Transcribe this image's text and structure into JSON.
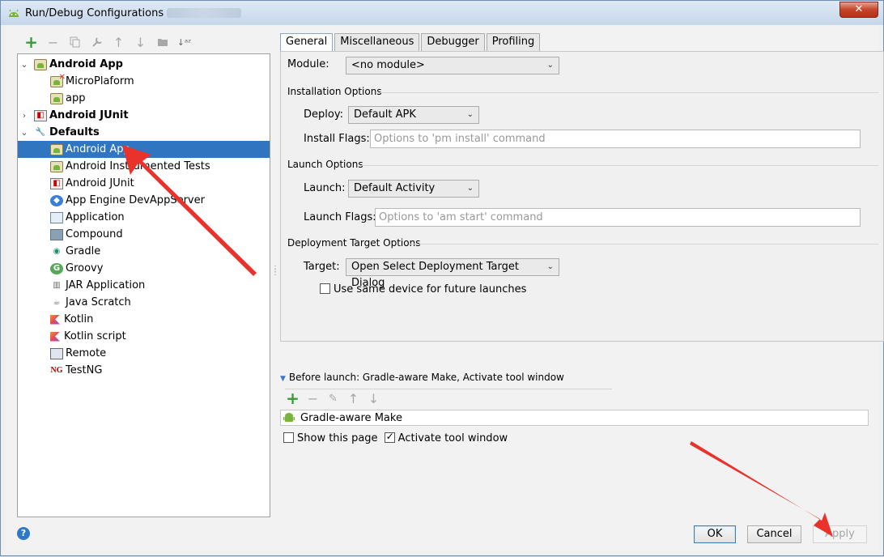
{
  "window": {
    "title": "Run/Debug Configurations",
    "close_label": "✕"
  },
  "left_toolbar": {
    "add_icon": "plus-icon",
    "remove_icon": "minus-icon",
    "copy_icon": "copy-icon",
    "edit_defaults_icon": "wrench-icon",
    "move_up_icon": "arrow-up-icon",
    "move_down_icon": "arrow-down-icon",
    "folder_icon": "folder-icon",
    "sort_icon": "sort-az-icon"
  },
  "tree": {
    "items": [
      {
        "label": "Android App",
        "level": 0,
        "bold": true,
        "expanded": true,
        "icon": "android-icon"
      },
      {
        "label": "MicroPlaform",
        "level": 1,
        "bold": false,
        "icon": "android-error-icon"
      },
      {
        "label": "app",
        "level": 1,
        "bold": false,
        "icon": "android-icon"
      },
      {
        "label": "Android JUnit",
        "level": 0,
        "bold": true,
        "expanded": false,
        "icon": "junit-icon"
      },
      {
        "label": "Defaults",
        "level": 0,
        "bold": true,
        "expanded": true,
        "icon": "wrench-icon"
      },
      {
        "label": "Android App",
        "level": 1,
        "bold": false,
        "selected": true,
        "icon": "android-icon"
      },
      {
        "label": "Android Instrumented Tests",
        "level": 1,
        "bold": false,
        "icon": "android-icon"
      },
      {
        "label": "Android JUnit",
        "level": 1,
        "bold": false,
        "icon": "junit-icon"
      },
      {
        "label": "App Engine DevAppServer",
        "level": 1,
        "bold": false,
        "icon": "appengine-icon"
      },
      {
        "label": "Application",
        "level": 1,
        "bold": false,
        "icon": "application-icon"
      },
      {
        "label": "Compound",
        "level": 1,
        "bold": false,
        "icon": "compound-icon"
      },
      {
        "label": "Gradle",
        "level": 1,
        "bold": false,
        "icon": "gradle-icon"
      },
      {
        "label": "Groovy",
        "level": 1,
        "bold": false,
        "icon": "groovy-icon"
      },
      {
        "label": "JAR Application",
        "level": 1,
        "bold": false,
        "icon": "jar-icon"
      },
      {
        "label": "Java Scratch",
        "level": 1,
        "bold": false,
        "icon": "java-scratch-icon"
      },
      {
        "label": "Kotlin",
        "level": 1,
        "bold": false,
        "icon": "kotlin-icon"
      },
      {
        "label": "Kotlin script",
        "level": 1,
        "bold": false,
        "icon": "kotlin-icon"
      },
      {
        "label": "Remote",
        "level": 1,
        "bold": false,
        "icon": "remote-icon"
      },
      {
        "label": "TestNG",
        "level": 1,
        "bold": false,
        "icon": "testng-icon"
      }
    ]
  },
  "tabs": [
    {
      "label": "General",
      "active": true
    },
    {
      "label": "Miscellaneous",
      "active": false
    },
    {
      "label": "Debugger",
      "active": false
    },
    {
      "label": "Profiling",
      "active": false
    }
  ],
  "general": {
    "module_label": "Module:",
    "module_value": "<no module>",
    "installation_options": "Installation Options",
    "deploy_label": "Deploy:",
    "deploy_value": "Default APK",
    "install_flags_label": "Install Flags:",
    "install_flags_placeholder": "Options to 'pm install' command",
    "install_flags_value": "",
    "launch_options": "Launch Options",
    "launch_label": "Launch:",
    "launch_value": "Default Activity",
    "launch_flags_label": "Launch Flags:",
    "launch_flags_placeholder": "Options to 'am start' command",
    "launch_flags_value": "",
    "deployment_target_options": "Deployment Target Options",
    "target_label": "Target:",
    "target_value": "Open Select Deployment Target Dialog",
    "same_device_label": "Use same device for future launches",
    "same_device_checked": false
  },
  "before_launch": {
    "title": "Before launch: Gradle-aware Make, Activate tool window",
    "tasks": [
      "Gradle-aware Make"
    ],
    "show_this_page_label": "Show this page",
    "show_this_page_checked": false,
    "activate_tool_window_label": "Activate tool window",
    "activate_tool_window_checked": true
  },
  "buttons": {
    "ok": "OK",
    "cancel": "Cancel",
    "apply": "Apply",
    "help": "?"
  },
  "colors": {
    "selection": "#2f75c0",
    "annotation_arrow": "#e8322b",
    "add_green": "#3a9a3a"
  }
}
